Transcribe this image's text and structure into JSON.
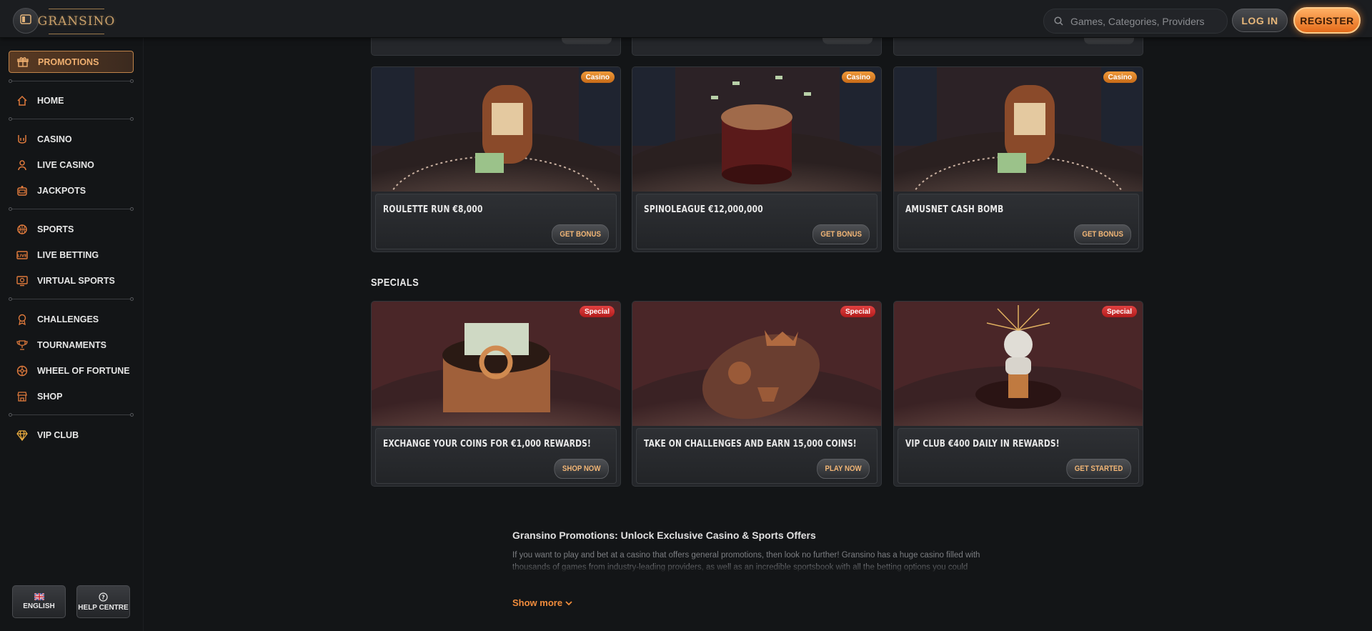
{
  "header": {
    "logo_text": "GRANSINO",
    "search_placeholder": "Games, Categories, Providers",
    "login_label": "LOG IN",
    "register_label": "REGISTER"
  },
  "sidebar": {
    "promotions_label": "PROMOTIONS",
    "items": [
      {
        "label": "HOME",
        "icon": "home-icon"
      },
      {
        "label": "CASINO",
        "icon": "casino-icon"
      },
      {
        "label": "LIVE CASINO",
        "icon": "live-casino-icon"
      },
      {
        "label": "JACKPOTS",
        "icon": "jackpot-icon"
      },
      {
        "label": "SPORTS",
        "icon": "sports-icon"
      },
      {
        "label": "LIVE BETTING",
        "icon": "live-betting-icon"
      },
      {
        "label": "VIRTUAL SPORTS",
        "icon": "virtual-sports-icon"
      },
      {
        "label": "CHALLENGES",
        "icon": "challenges-icon"
      },
      {
        "label": "TOURNAMENTS",
        "icon": "trophy-icon"
      },
      {
        "label": "WHEEL OF FORTUNE",
        "icon": "wheel-icon"
      },
      {
        "label": "SHOP",
        "icon": "shop-icon"
      },
      {
        "label": "VIP CLUB",
        "icon": "diamond-icon"
      }
    ],
    "language_label": "ENGLISH",
    "help_label": "HELP CENTRE"
  },
  "casino_cards": [
    {
      "title": "ROULETTE RUN €8,000",
      "badge": "Casino",
      "cta": "GET BONUS"
    },
    {
      "title": "SPINOLEAGUE €12,000,000",
      "badge": "Casino",
      "cta": "GET BONUS"
    },
    {
      "title": "AMUSNET CASH BOMB",
      "badge": "Casino",
      "cta": "GET BONUS"
    }
  ],
  "specials": {
    "title": "SPECIALS",
    "cards": [
      {
        "title": "EXCHANGE YOUR COINS FOR €1,000 REWARDS!",
        "badge": "Special",
        "cta": "SHOP NOW"
      },
      {
        "title": "TAKE ON CHALLENGES AND EARN 15,000 COINS!",
        "badge": "Special",
        "cta": "PLAY NOW"
      },
      {
        "title": "VIP CLUB €400 DAILY IN REWARDS!",
        "badge": "Special",
        "cta": "GET STARTED"
      }
    ]
  },
  "seo": {
    "title": "Gransino Promotions: Unlock Exclusive Casino & Sports Offers",
    "text": "If you want to play and bet at a casino that offers general promotions, then look no further! Gransino has a huge casino filled with thousands of games from industry-leading providers, as well as an incredible sportsbook with all the betting options you could",
    "show_more": "Show more"
  },
  "colors": {
    "accent": "#f08c3c",
    "casino_badge": "#e07f2a",
    "special_badge": "#d32f2f",
    "background": "#131517"
  }
}
